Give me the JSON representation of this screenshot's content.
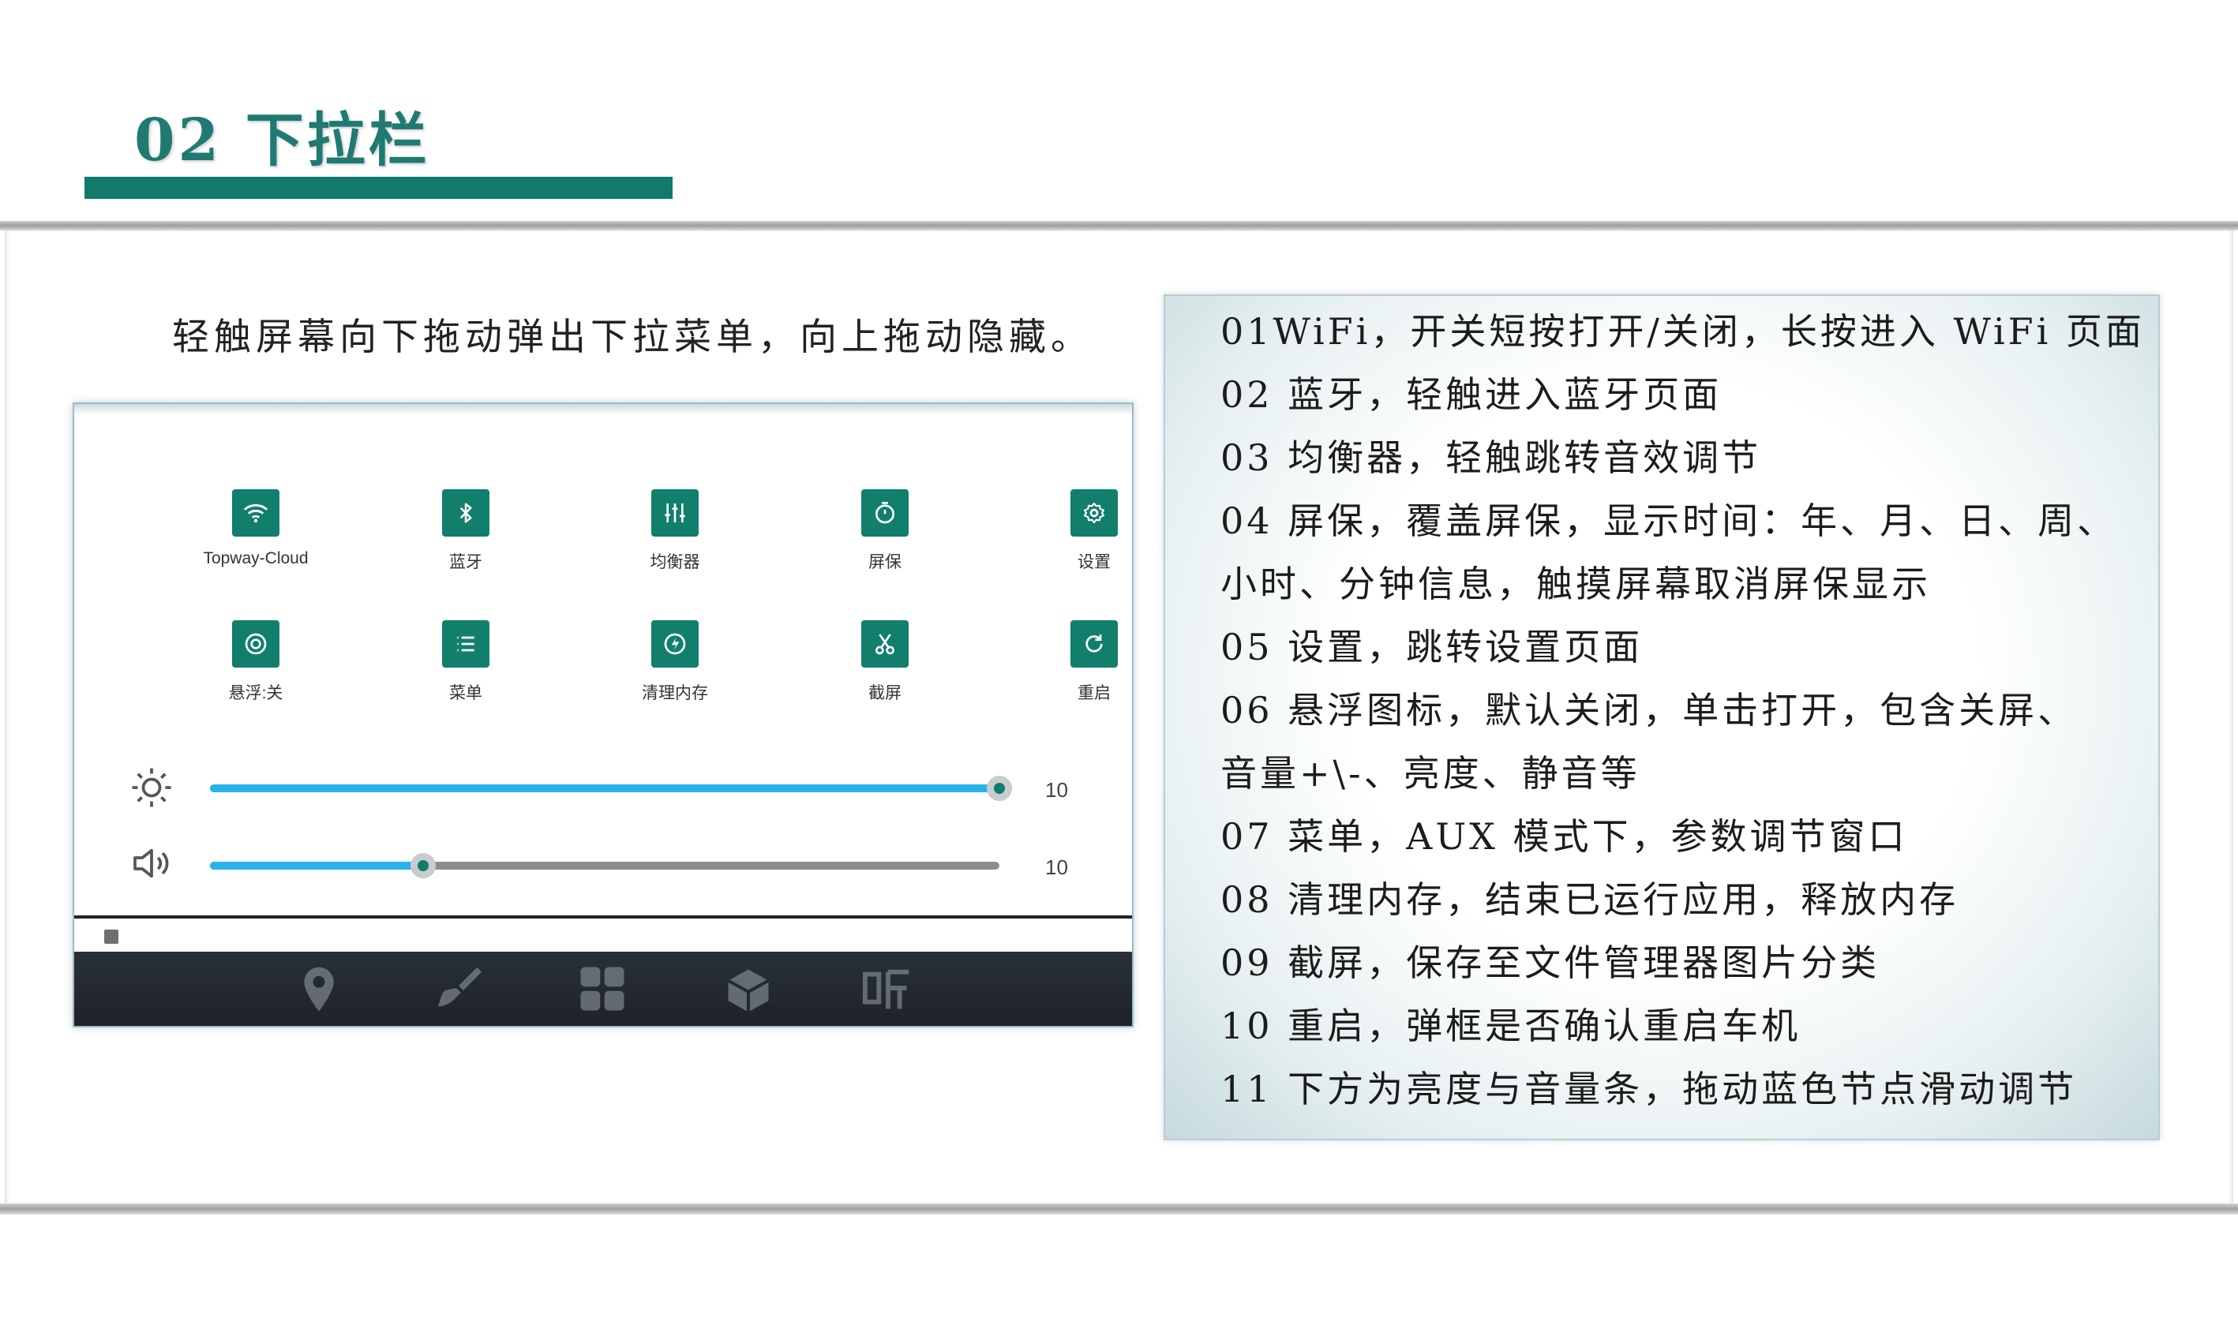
{
  "section": {
    "heading": "02 下拉栏"
  },
  "intro": "轻触屏幕向下拖动弹出下拉菜单，向上拖动隐藏。",
  "panel": {
    "tiles": [
      {
        "label": "Topway-Cloud",
        "icon": "wifi-icon"
      },
      {
        "label": "蓝牙",
        "icon": "bluetooth-icon"
      },
      {
        "label": "均衡器",
        "icon": "equalizer-icon"
      },
      {
        "label": "屏保",
        "icon": "timer-icon"
      },
      {
        "label": "设置",
        "icon": "settings-icon"
      },
      {
        "label": "悬浮:关",
        "icon": "floating-icon"
      },
      {
        "label": "菜单",
        "icon": "menu-icon"
      },
      {
        "label": "清理内存",
        "icon": "clean-memory-icon"
      },
      {
        "label": "截屏",
        "icon": "scissors-icon"
      },
      {
        "label": "重启",
        "icon": "restart-icon"
      }
    ],
    "brightness": {
      "value": "10",
      "level_pct": 100,
      "icon": "sun-icon"
    },
    "volume": {
      "value": "10",
      "level_pct": 27,
      "icon": "speaker-icon"
    },
    "dock_icons": [
      "map-pin-icon",
      "brush-icon",
      "apps-grid-icon",
      "media-box-icon",
      "listen-icon"
    ],
    "colors": {
      "tile": "#117f6b",
      "slider_fill": "#27b3ea",
      "dock": "#1d2228"
    }
  },
  "description": [
    "01WiFi，开关短按打开/关闭，长按进入 WiFi 页面",
    "02 蓝牙，轻触进入蓝牙页面",
    "03 均衡器，轻触跳转音效调节",
    "04 屏保，覆盖屏保，显示时间：年、月、日、周、",
    "小时、分钟信息，触摸屏幕取消屏保显示",
    "05 设置，跳转设置页面",
    "06 悬浮图标，默认关闭，单击打开，包含关屏、",
    "音量+\\-、亮度、静音等",
    "07 菜单，AUX 模式下，参数调节窗口",
    "08 清理内存，结束已运行应用，释放内存",
    "09 截屏，保存至文件管理器图片分类",
    "10 重启，弹框是否确认重启车机",
    "11 下方为亮度与音量条，拖动蓝色节点滑动调节"
  ],
  "theme": {
    "accent": "#117a6a",
    "heading_color": "#1f7a72"
  }
}
